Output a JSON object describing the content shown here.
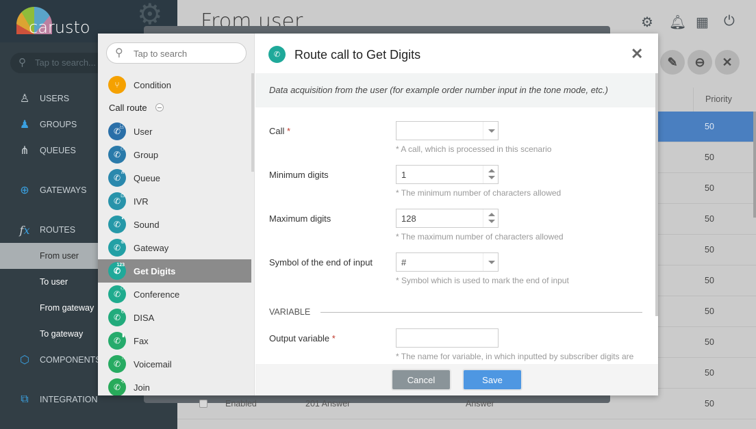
{
  "brand": {
    "logo_text": "carusto"
  },
  "sidebar": {
    "search_placeholder": "Tap to search...",
    "items": [
      {
        "label": "USERS",
        "icon": "user-icon"
      },
      {
        "label": "GROUPS",
        "icon": "group-icon"
      },
      {
        "label": "QUEUES",
        "icon": "queue-icon"
      },
      {
        "label": "GATEWAYS",
        "icon": "globe-icon"
      },
      {
        "label": "ROUTES",
        "icon": "fx-icon"
      },
      {
        "label": "COMPONENTS",
        "icon": "cube-icon"
      },
      {
        "label": "INTEGRATION",
        "icon": "integration-icon"
      }
    ],
    "route_subitems": [
      {
        "label": "From user",
        "active": true
      },
      {
        "label": "To user"
      },
      {
        "label": "From gateway"
      },
      {
        "label": "To gateway"
      }
    ]
  },
  "main": {
    "title": "From user",
    "priority_header": "Priority",
    "priorities": [
      "50",
      "50",
      "50",
      "50",
      "50",
      "50",
      "50",
      "50",
      "50",
      "50"
    ],
    "last_row": {
      "status": "Enabled",
      "code": "201 Answer",
      "action": "Answer"
    }
  },
  "dialog": {
    "search_placeholder": "Tap to search",
    "condition_label": "Condition",
    "group_label": "Call route",
    "components": [
      {
        "label": "User",
        "color": "#2a6fa8"
      },
      {
        "label": "Group",
        "color": "#2a7aaa"
      },
      {
        "label": "Queue",
        "color": "#2a88ad"
      },
      {
        "label": "IVR",
        "color": "#2893aa"
      },
      {
        "label": "Sound",
        "color": "#2598a8"
      },
      {
        "label": "Gateway",
        "color": "#22a0a5"
      },
      {
        "label": "Get Digits",
        "color": "#1fa99a",
        "active": true
      },
      {
        "label": "Conference",
        "color": "#1fab8e"
      },
      {
        "label": "DISA",
        "color": "#22ab7c"
      },
      {
        "label": "Fax",
        "color": "#25ab6c"
      },
      {
        "label": "Voicemail",
        "color": "#27ab62"
      },
      {
        "label": "Join",
        "color": "#28aa5a"
      }
    ],
    "title": "Route call to Get Digits",
    "description": "Data acquisition from the user (for example order number input in the tone mode, etc.)",
    "fields": {
      "call": {
        "label": "Call",
        "required": "*",
        "value": "",
        "hint": "* A call, which is processed in this scenario"
      },
      "min_digits": {
        "label": "Minimum digits",
        "value": "1",
        "hint": "* The minimum number of characters allowed"
      },
      "max_digits": {
        "label": "Maximum digits",
        "value": "128",
        "hint": "* The maximum number of characters allowed"
      },
      "end_symbol": {
        "label": "Symbol of the end of input",
        "value": "#",
        "hint": "* Symbol which is used to mark the end of input"
      },
      "output_var": {
        "label": "Output variable",
        "required": "*",
        "value": "",
        "hint": "* The name for variable, in which inputted by subscriber digits are"
      }
    },
    "section_variable": "VARIABLE",
    "cancel_label": "Cancel",
    "save_label": "Save"
  },
  "colors": {
    "accent": "#4e97e2",
    "selected_row": "#4a7fc0",
    "condition": "#f5a100"
  }
}
